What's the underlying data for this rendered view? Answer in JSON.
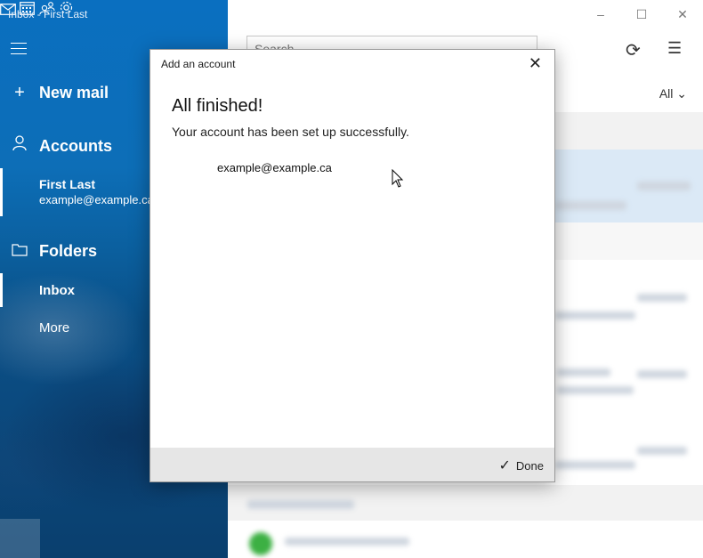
{
  "window": {
    "title": "Inbox - First Last",
    "minimize": "–",
    "maximize": "☐",
    "close": "✕"
  },
  "sidebar": {
    "new_mail": "New mail",
    "accounts": "Accounts",
    "account_name": "First Last",
    "account_email": "example@example.ca",
    "folders": "Folders",
    "inbox": "Inbox",
    "more": "More"
  },
  "main": {
    "search_placeholder": "Search",
    "filter": "All"
  },
  "dialog": {
    "title": "Add an account",
    "heading": "All finished!",
    "message": "Your account has been set up successfully.",
    "email": "example@example.ca",
    "done": "Done"
  },
  "colors": {
    "sidebar": "#0a6fc0",
    "highlight": "#dbe9f6",
    "footer": "#e6e6e6"
  }
}
